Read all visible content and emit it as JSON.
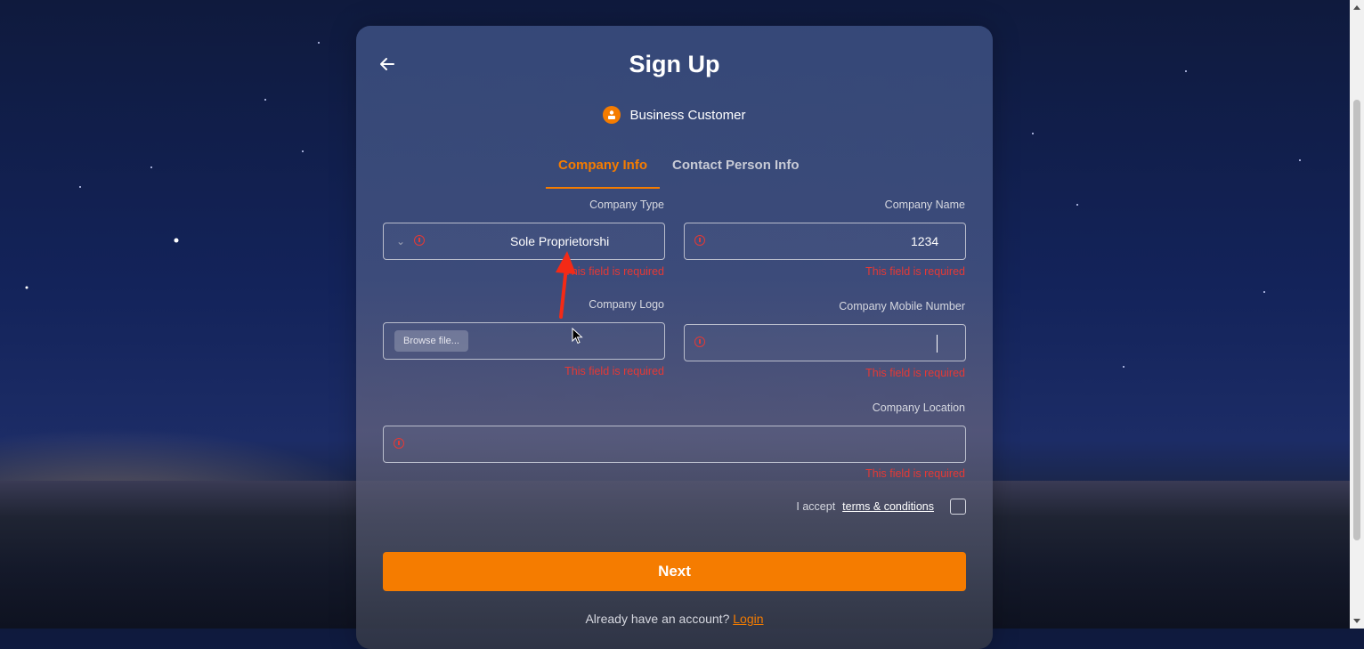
{
  "header": {
    "title": "Sign Up",
    "back_icon": "arrow-left-icon"
  },
  "role": {
    "label": "Business Customer",
    "icon": "business-person-icon",
    "color": "#f57c00"
  },
  "tabs": [
    {
      "label": "Company Info",
      "active": true
    },
    {
      "label": "Contact Person Info",
      "active": false
    }
  ],
  "fields": {
    "company_type": {
      "label": "Company Type",
      "value": "Sole Proprietorshi",
      "error": "This field is required"
    },
    "company_name": {
      "label": "Company Name",
      "value": "1234",
      "error": "This field is required"
    },
    "company_logo": {
      "label": "Company Logo",
      "browse_label": "Browse file...",
      "error": "This field is required"
    },
    "company_mobile": {
      "label": "Company Mobile Number",
      "value": "",
      "error": "This field is required"
    },
    "company_location": {
      "label": "Company Location",
      "value": "",
      "error": "This field is required"
    }
  },
  "terms": {
    "prefix": "I accept",
    "link": "terms & conditions",
    "checked": false
  },
  "actions": {
    "next_label": "Next"
  },
  "footer": {
    "prompt": "Already have an account?",
    "login_label": "Login"
  },
  "colors": {
    "accent": "#f57c00",
    "error": "#e53935"
  }
}
